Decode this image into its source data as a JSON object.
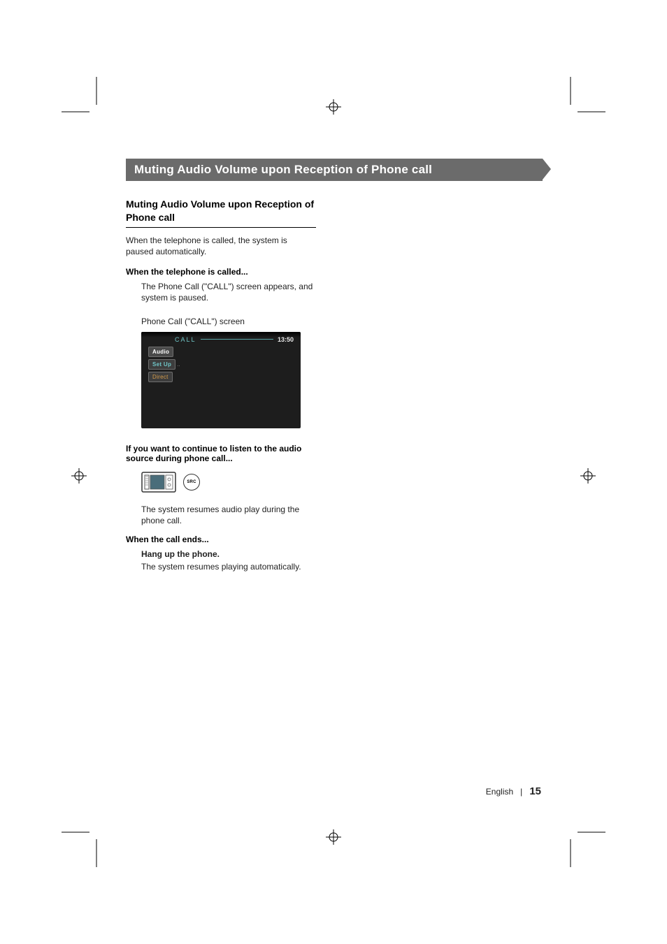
{
  "banner_title": "Muting Audio Volume upon Reception of Phone call",
  "subtitle": "Muting Audio Volume upon Reception of Phone call",
  "intro": "When the telephone is called, the system is paused automatically.",
  "sec1_heading": "When the telephone is called...",
  "sec1_body": "The Phone Call (\"CALL\") screen appears, and system is paused.",
  "screen_caption": "Phone Call (\"CALL\") screen",
  "screen": {
    "label": "CALL",
    "time": "13:50",
    "items": {
      "audio": "Audio",
      "setup": "Set Up",
      "direct": "Direct"
    }
  },
  "sec2_heading": "If you want to continue to listen to the audio source during phone call...",
  "src_label": "SRC",
  "sec2_body": "The system resumes audio play during the phone call.",
  "sec3_heading": "When the call ends...",
  "sec3_sub": "Hang up the phone.",
  "sec3_body": "The system resumes playing automatically.",
  "footer_lang": "English",
  "footer_sep": "|",
  "footer_page": "15"
}
